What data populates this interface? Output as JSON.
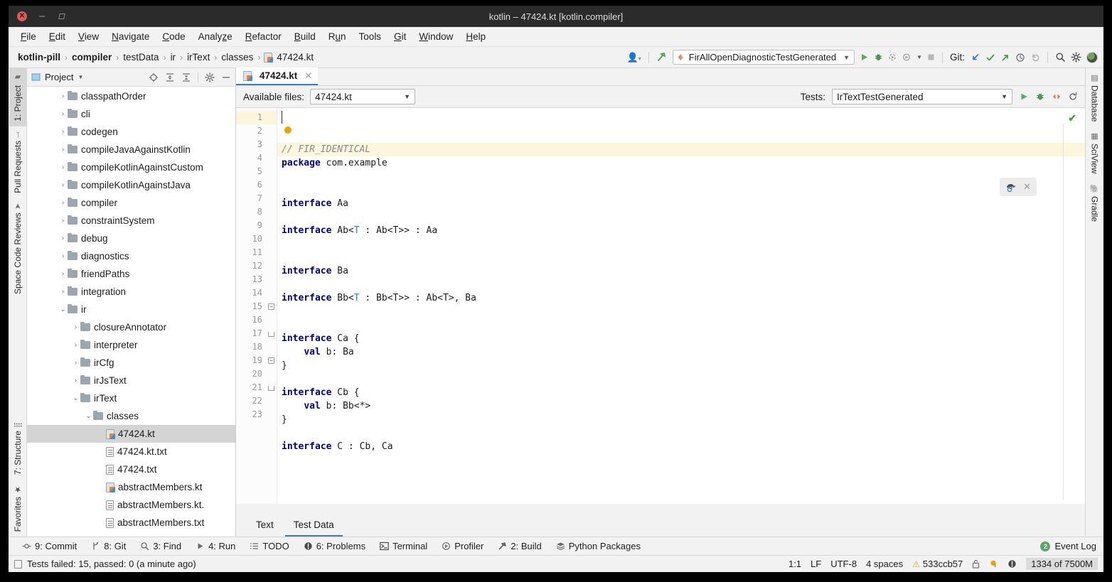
{
  "window": {
    "title": "kotlin – 47424.kt [kotlin.compiler]",
    "close_icon": "close-icon",
    "minimize_icon": "minimize-icon",
    "maximize_icon": "maximize-icon"
  },
  "menubar": {
    "items": [
      {
        "label": "File"
      },
      {
        "label": "Edit"
      },
      {
        "label": "View"
      },
      {
        "label": "Navigate"
      },
      {
        "label": "Code"
      },
      {
        "label": "Analyze"
      },
      {
        "label": "Refactor"
      },
      {
        "label": "Build"
      },
      {
        "label": "Run"
      },
      {
        "label": "Tools"
      },
      {
        "label": "Git"
      },
      {
        "label": "Window"
      },
      {
        "label": "Help"
      }
    ]
  },
  "navbar": {
    "breadcrumbs": [
      {
        "label": "kotlin-pill",
        "bold": true
      },
      {
        "label": "compiler",
        "bold": true
      },
      {
        "label": "testData",
        "bold": false
      },
      {
        "label": "ir",
        "bold": false
      },
      {
        "label": "irText",
        "bold": false
      },
      {
        "label": "classes",
        "bold": false
      },
      {
        "label": "47424.kt",
        "bold": false
      }
    ],
    "separator": "›",
    "run_config": "FirAllOpenDiagnosticTestGenerated",
    "git_label": "Git:",
    "icons": {
      "profile": "user-profile-icon",
      "build": "build-hammer-icon",
      "run": "run-icon",
      "debug": "debug-icon",
      "run_coverage": "run-with-coverage-icon",
      "profiler": "profiler-icon",
      "stop": "stop-icon",
      "git_update": "git-update-icon",
      "git_commit": "git-commit-icon",
      "git_push": "git-push-icon",
      "git_history": "git-history-icon",
      "git_rollback": "git-rollback-icon",
      "search": "search-icon",
      "settings": "settings-gear-icon",
      "avatar": "user-avatar"
    }
  },
  "left_strip": {
    "tabs": [
      {
        "label": "1: Project",
        "icon": "project-icon",
        "active": true
      },
      {
        "label": "Pull Requests",
        "icon": "pull-requests-icon",
        "active": false
      },
      {
        "label": "Space Code Reviews",
        "icon": "space-icon",
        "active": false
      }
    ],
    "bottom_tabs": [
      {
        "label": "7: Structure",
        "icon": "structure-icon"
      },
      {
        "label": "Favorites",
        "icon": "star-icon"
      }
    ]
  },
  "right_strip": {
    "tabs": [
      {
        "label": "Database",
        "icon": "database-icon"
      },
      {
        "label": "SciView",
        "icon": "sciview-icon"
      },
      {
        "label": "Gradle",
        "icon": "gradle-elephant-icon"
      }
    ]
  },
  "project_panel": {
    "title": "Project",
    "caret_icon": "chevron-down-icon",
    "tools": [
      {
        "name": "locate-icon"
      },
      {
        "name": "expand-all-icon"
      },
      {
        "name": "collapse-all-icon"
      },
      {
        "name": "settings-gear-icon"
      },
      {
        "name": "hide-icon"
      }
    ],
    "tree": [
      {
        "label": "classpathOrder",
        "indent": 2,
        "type": "folder",
        "state": "collapsed"
      },
      {
        "label": "cli",
        "indent": 2,
        "type": "folder",
        "state": "collapsed"
      },
      {
        "label": "codegen",
        "indent": 2,
        "type": "folder",
        "state": "collapsed"
      },
      {
        "label": "compileJavaAgainstKotlin",
        "indent": 2,
        "type": "folder",
        "state": "collapsed"
      },
      {
        "label": "compileKotlinAgainstCustom",
        "indent": 2,
        "type": "folder",
        "state": "collapsed"
      },
      {
        "label": "compileKotlinAgainstJava",
        "indent": 2,
        "type": "folder",
        "state": "collapsed"
      },
      {
        "label": "compiler",
        "indent": 2,
        "type": "folder",
        "state": "collapsed"
      },
      {
        "label": "constraintSystem",
        "indent": 2,
        "type": "folder",
        "state": "collapsed"
      },
      {
        "label": "debug",
        "indent": 2,
        "type": "folder",
        "state": "collapsed"
      },
      {
        "label": "diagnostics",
        "indent": 2,
        "type": "folder",
        "state": "collapsed"
      },
      {
        "label": "friendPaths",
        "indent": 2,
        "type": "folder",
        "state": "collapsed"
      },
      {
        "label": "integration",
        "indent": 2,
        "type": "folder",
        "state": "collapsed"
      },
      {
        "label": "ir",
        "indent": 2,
        "type": "folder",
        "state": "expanded"
      },
      {
        "label": "closureAnnotator",
        "indent": 3,
        "type": "folder",
        "state": "collapsed"
      },
      {
        "label": "interpreter",
        "indent": 3,
        "type": "folder",
        "state": "collapsed"
      },
      {
        "label": "irCfg",
        "indent": 3,
        "type": "folder",
        "state": "collapsed"
      },
      {
        "label": "irJsText",
        "indent": 3,
        "type": "folder",
        "state": "collapsed"
      },
      {
        "label": "irText",
        "indent": 3,
        "type": "folder",
        "state": "expanded"
      },
      {
        "label": "classes",
        "indent": 4,
        "type": "folder",
        "state": "expanded"
      },
      {
        "label": "47424.kt",
        "indent": 5,
        "type": "kt",
        "state": "none",
        "selected": true
      },
      {
        "label": "47424.kt.txt",
        "indent": 5,
        "type": "txt",
        "state": "none"
      },
      {
        "label": "47424.txt",
        "indent": 5,
        "type": "txt",
        "state": "none"
      },
      {
        "label": "abstractMembers.kt",
        "indent": 5,
        "type": "kt",
        "state": "none"
      },
      {
        "label": "abstractMembers.kt.",
        "indent": 5,
        "type": "txt",
        "state": "none"
      },
      {
        "label": "abstractMembers.txt",
        "indent": 5,
        "type": "txt",
        "state": "none"
      }
    ]
  },
  "editor": {
    "tab": {
      "label": "47424.kt",
      "icon": "kotlin-file-icon",
      "close_icon": "close-icon"
    },
    "available_files_label": "Available files:",
    "available_files_value": "47424.kt",
    "tests_label": "Tests:",
    "tests_value": "IrTextTestGenerated",
    "toolbar_icons": {
      "run": "run-icon",
      "debug": "debug-icon",
      "diff": "diff-icon",
      "refresh": "refresh-icon"
    },
    "inspection_status_icon": "inspections-ok-icon",
    "popup": {
      "icon": "gradle-refresh-icon",
      "close_icon": "close-icon"
    },
    "code_lines": [
      {
        "n": 1,
        "tokens": [
          {
            "t": "// FIR_IDENTICAL",
            "c": "cmt"
          }
        ],
        "fold": "",
        "current": true
      },
      {
        "n": 2,
        "tokens": [
          {
            "t": "package",
            "c": "kw"
          },
          {
            "t": " com.example",
            "c": "plain"
          }
        ],
        "fold": ""
      },
      {
        "n": 3,
        "tokens": [],
        "fold": ""
      },
      {
        "n": 4,
        "tokens": [],
        "fold": ""
      },
      {
        "n": 5,
        "tokens": [
          {
            "t": "interface",
            "c": "kw"
          },
          {
            "t": " Aa",
            "c": "plain"
          }
        ],
        "fold": ""
      },
      {
        "n": 6,
        "tokens": [],
        "fold": ""
      },
      {
        "n": 7,
        "tokens": [
          {
            "t": "interface",
            "c": "kw"
          },
          {
            "t": " Ab<",
            "c": "plain"
          },
          {
            "t": "T",
            "c": "tparam"
          },
          {
            "t": " : Ab<T>> : Aa",
            "c": "plain"
          }
        ],
        "fold": ""
      },
      {
        "n": 8,
        "tokens": [],
        "fold": ""
      },
      {
        "n": 9,
        "tokens": [],
        "fold": ""
      },
      {
        "n": 10,
        "tokens": [
          {
            "t": "interface",
            "c": "kw"
          },
          {
            "t": " Ba",
            "c": "plain"
          }
        ],
        "fold": ""
      },
      {
        "n": 11,
        "tokens": [],
        "fold": ""
      },
      {
        "n": 12,
        "tokens": [
          {
            "t": "interface",
            "c": "kw"
          },
          {
            "t": " Bb<",
            "c": "plain"
          },
          {
            "t": "T",
            "c": "tparam"
          },
          {
            "t": " : Bb<T>> : Ab<T>, Ba",
            "c": "plain"
          }
        ],
        "fold": ""
      },
      {
        "n": 13,
        "tokens": [],
        "fold": ""
      },
      {
        "n": 14,
        "tokens": [],
        "fold": ""
      },
      {
        "n": 15,
        "tokens": [
          {
            "t": "interface",
            "c": "kw"
          },
          {
            "t": " Ca {",
            "c": "plain"
          }
        ],
        "fold": "open"
      },
      {
        "n": 16,
        "tokens": [
          {
            "t": "    ",
            "c": "plain"
          },
          {
            "t": "val",
            "c": "kw"
          },
          {
            "t": " b: Ba",
            "c": "plain"
          }
        ],
        "fold": ""
      },
      {
        "n": 17,
        "tokens": [
          {
            "t": "}",
            "c": "plain"
          }
        ],
        "fold": "close"
      },
      {
        "n": 18,
        "tokens": [],
        "fold": ""
      },
      {
        "n": 19,
        "tokens": [
          {
            "t": "interface",
            "c": "kw"
          },
          {
            "t": " Cb {",
            "c": "plain"
          }
        ],
        "fold": "open"
      },
      {
        "n": 20,
        "tokens": [
          {
            "t": "    ",
            "c": "plain"
          },
          {
            "t": "val",
            "c": "kw"
          },
          {
            "t": " b: Bb<*>",
            "c": "plain"
          }
        ],
        "fold": ""
      },
      {
        "n": 21,
        "tokens": [
          {
            "t": "}",
            "c": "plain"
          }
        ],
        "fold": "close"
      },
      {
        "n": 22,
        "tokens": [],
        "fold": ""
      },
      {
        "n": 23,
        "tokens": [
          {
            "t": "interface",
            "c": "kw"
          },
          {
            "t": " C : Cb, Ca",
            "c": "plain"
          }
        ],
        "fold": ""
      }
    ],
    "bottom_tabs": [
      {
        "label": "Text",
        "active": false
      },
      {
        "label": "Test Data",
        "active": true
      }
    ]
  },
  "bottom_strip": {
    "tools": [
      {
        "label": "9: Commit",
        "icon": "commit-icon",
        "mnemonic": "9"
      },
      {
        "label": "8: Git",
        "icon": "git-branch-icon",
        "mnemonic": "8"
      },
      {
        "label": "3: Find",
        "icon": "search-icon",
        "mnemonic": "3"
      },
      {
        "label": "4: Run",
        "icon": "run-icon",
        "mnemonic": "4"
      },
      {
        "label": "TODO",
        "icon": "todo-list-icon",
        "mnemonic": ""
      },
      {
        "label": "6: Problems",
        "icon": "problems-icon",
        "mnemonic": "6"
      },
      {
        "label": "Terminal",
        "icon": "terminal-icon",
        "mnemonic": ""
      },
      {
        "label": "Profiler",
        "icon": "profiler-icon",
        "mnemonic": ""
      },
      {
        "label": "2: Build",
        "icon": "build-hammer-icon",
        "mnemonic": "2"
      },
      {
        "label": "Python Packages",
        "icon": "python-packages-icon",
        "mnemonic": ""
      }
    ],
    "event_log": {
      "label": "Event Log",
      "badge": "2"
    }
  },
  "statusbar": {
    "message": "Tests failed: 15, passed: 0 (a minute ago)",
    "message_icon": "console-icon",
    "caret_position": "1:1",
    "line_separator": "LF",
    "encoding": "UTF-8",
    "indent": "4 spaces",
    "git_branch": "533ccb57",
    "branch_icon": "warning-icon",
    "lock_icon": "read-only-lock-icon",
    "inspection_icon": "inspection-level-icon",
    "info_icon": "notification-icon",
    "memory": "1334 of 7500M"
  },
  "colors": {
    "accent_blue": "#3d7cc9",
    "green": "#59a869",
    "orange": "#e8734a",
    "yellow": "#e8a400",
    "panel_bg": "#f2f2f2",
    "editor_bg": "#ffffff",
    "current_line": "#fdf6dd",
    "selection": "#d4d4d4",
    "keyword": "#000080",
    "comment": "#8c8c8c",
    "type_param": "#20999d"
  }
}
